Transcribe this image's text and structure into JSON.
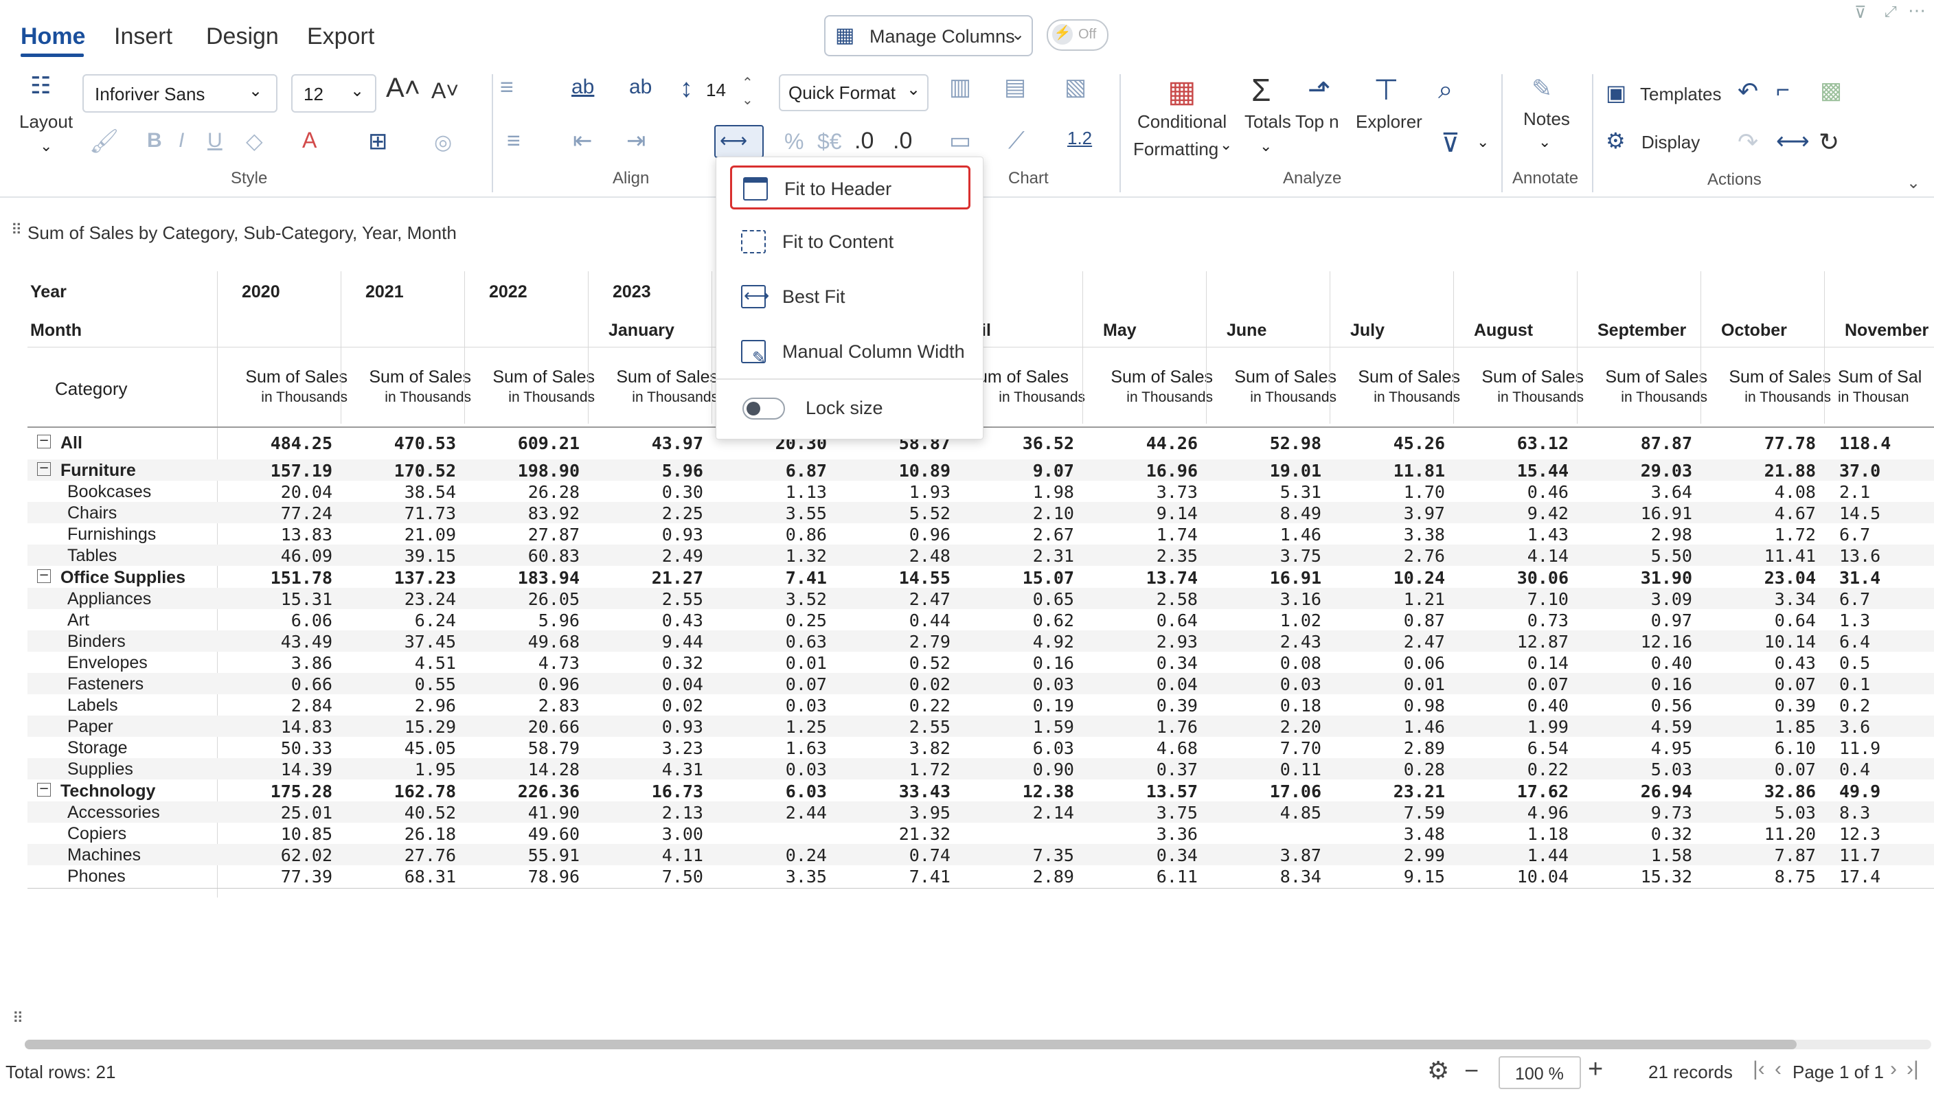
{
  "tabs": [
    "Home",
    "Insert",
    "Design",
    "Export"
  ],
  "manage_columns": {
    "label": "Manage Columns",
    "toggle": "Off"
  },
  "style_group": {
    "label": "Style",
    "layout_label": "Layout",
    "font_family": "Inforiver Sans",
    "font_size": "12",
    "bold": "B",
    "italic": "I",
    "underline": "U"
  },
  "align_group": {
    "label": "Align",
    "line_height": "14",
    "wrap": "ab",
    "wrap2": "ab"
  },
  "number_group": {
    "quick_format": "Quick Format",
    "percent": "%",
    "currency": "$€",
    "inc": ".0",
    "dec": ".0",
    "scale": "1.2"
  },
  "chart_group": {
    "label": "Chart"
  },
  "analyze_group": {
    "label": "Analyze",
    "conditional": "Conditional",
    "formatting": "Formatting",
    "totals": "Totals",
    "top_n": "Top n",
    "explorer": "Explorer"
  },
  "annotate_group": {
    "label": "Annotate",
    "notes": "Notes"
  },
  "actions_group": {
    "label": "Actions",
    "templates": "Templates",
    "display": "Display"
  },
  "title": "Sum of Sales by Category, Sub-Category, Year, Month",
  "popup_menu": {
    "fit_header": "Fit to Header",
    "fit_content": "Fit to Content",
    "best_fit": "Best Fit",
    "manual": "Manual Column Width",
    "lock": "Lock size"
  },
  "header": {
    "year_label": "Year",
    "month_label": "Month",
    "category_label": "Category",
    "years": [
      "2020",
      "2021",
      "2022",
      "2023"
    ],
    "months": [
      "January",
      "April",
      "May",
      "June",
      "July",
      "August",
      "September",
      "October",
      "November"
    ],
    "measure": "Sum of Sales",
    "measure_sub": "in Thousands",
    "measure_partial": "um of Sales",
    "measure_cut": "Sum of Sal",
    "sub_cut": "in Thousan"
  },
  "rows": [
    {
      "cat": "All",
      "level": 0,
      "bold": true,
      "toggle": true,
      "vals": [
        "484.25",
        "470.53",
        "609.21",
        "43.97",
        "20.30",
        "58.87",
        "36.52",
        "44.26",
        "52.98",
        "45.26",
        "63.12",
        "87.87",
        "77.78",
        "118.4"
      ]
    },
    {
      "cat": "Furniture",
      "level": 0,
      "bold": true,
      "toggle": true,
      "vals": [
        "157.19",
        "170.52",
        "198.90",
        "5.96",
        "6.87",
        "10.89",
        "9.07",
        "16.96",
        "19.01",
        "11.81",
        "15.44",
        "29.03",
        "21.88",
        "37.0"
      ]
    },
    {
      "cat": "Bookcases",
      "level": 1,
      "vals": [
        "20.04",
        "38.54",
        "26.28",
        "0.30",
        "1.13",
        "1.93",
        "1.98",
        "3.73",
        "5.31",
        "1.70",
        "0.46",
        "3.64",
        "4.08",
        "2.1"
      ]
    },
    {
      "cat": "Chairs",
      "level": 1,
      "vals": [
        "77.24",
        "71.73",
        "83.92",
        "2.25",
        "3.55",
        "5.52",
        "2.10",
        "9.14",
        "8.49",
        "3.97",
        "9.42",
        "16.91",
        "4.67",
        "14.5"
      ]
    },
    {
      "cat": "Furnishings",
      "level": 1,
      "vals": [
        "13.83",
        "21.09",
        "27.87",
        "0.93",
        "0.86",
        "0.96",
        "2.67",
        "1.74",
        "1.46",
        "3.38",
        "1.43",
        "2.98",
        "1.72",
        "6.7"
      ]
    },
    {
      "cat": "Tables",
      "level": 1,
      "vals": [
        "46.09",
        "39.15",
        "60.83",
        "2.49",
        "1.32",
        "2.48",
        "2.31",
        "2.35",
        "3.75",
        "2.76",
        "4.14",
        "5.50",
        "11.41",
        "13.6"
      ]
    },
    {
      "cat": "Office Supplies",
      "level": 0,
      "bold": true,
      "toggle": true,
      "vals": [
        "151.78",
        "137.23",
        "183.94",
        "21.27",
        "7.41",
        "14.55",
        "15.07",
        "13.74",
        "16.91",
        "10.24",
        "30.06",
        "31.90",
        "23.04",
        "31.4"
      ]
    },
    {
      "cat": "Appliances",
      "level": 1,
      "vals": [
        "15.31",
        "23.24",
        "26.05",
        "2.55",
        "3.52",
        "2.47",
        "0.65",
        "2.58",
        "3.16",
        "1.21",
        "7.10",
        "3.09",
        "3.34",
        "6.7"
      ]
    },
    {
      "cat": "Art",
      "level": 1,
      "vals": [
        "6.06",
        "6.24",
        "5.96",
        "0.43",
        "0.25",
        "0.44",
        "0.62",
        "0.64",
        "1.02",
        "0.87",
        "0.73",
        "0.97",
        "0.64",
        "1.3"
      ]
    },
    {
      "cat": "Binders",
      "level": 1,
      "vals": [
        "43.49",
        "37.45",
        "49.68",
        "9.44",
        "0.63",
        "2.79",
        "4.92",
        "2.93",
        "2.43",
        "2.47",
        "12.87",
        "12.16",
        "10.14",
        "6.4"
      ]
    },
    {
      "cat": "Envelopes",
      "level": 1,
      "vals": [
        "3.86",
        "4.51",
        "4.73",
        "0.32",
        "0.01",
        "0.52",
        "0.16",
        "0.34",
        "0.08",
        "0.06",
        "0.14",
        "0.40",
        "0.43",
        "0.5"
      ]
    },
    {
      "cat": "Fasteners",
      "level": 1,
      "vals": [
        "0.66",
        "0.55",
        "0.96",
        "0.04",
        "0.07",
        "0.02",
        "0.03",
        "0.04",
        "0.03",
        "0.01",
        "0.07",
        "0.16",
        "0.07",
        "0.1"
      ]
    },
    {
      "cat": "Labels",
      "level": 1,
      "vals": [
        "2.84",
        "2.96",
        "2.83",
        "0.02",
        "0.03",
        "0.22",
        "0.19",
        "0.39",
        "0.18",
        "0.98",
        "0.40",
        "0.56",
        "0.39",
        "0.2"
      ]
    },
    {
      "cat": "Paper",
      "level": 1,
      "vals": [
        "14.83",
        "15.29",
        "20.66",
        "0.93",
        "1.25",
        "2.55",
        "1.59",
        "1.76",
        "2.20",
        "1.46",
        "1.99",
        "4.59",
        "1.85",
        "3.6"
      ]
    },
    {
      "cat": "Storage",
      "level": 1,
      "vals": [
        "50.33",
        "45.05",
        "58.79",
        "3.23",
        "1.63",
        "3.82",
        "6.03",
        "4.68",
        "7.70",
        "2.89",
        "6.54",
        "4.95",
        "6.10",
        "11.9"
      ]
    },
    {
      "cat": "Supplies",
      "level": 1,
      "vals": [
        "14.39",
        "1.95",
        "14.28",
        "4.31",
        "0.03",
        "1.72",
        "0.90",
        "0.37",
        "0.11",
        "0.28",
        "0.22",
        "5.03",
        "0.07",
        "0.4"
      ]
    },
    {
      "cat": "Technology",
      "level": 0,
      "bold": true,
      "toggle": true,
      "vals": [
        "175.28",
        "162.78",
        "226.36",
        "16.73",
        "6.03",
        "33.43",
        "12.38",
        "13.57",
        "17.06",
        "23.21",
        "17.62",
        "26.94",
        "32.86",
        "49.9"
      ]
    },
    {
      "cat": "Accessories",
      "level": 1,
      "vals": [
        "25.01",
        "40.52",
        "41.90",
        "2.13",
        "2.44",
        "3.95",
        "2.14",
        "3.75",
        "4.85",
        "7.59",
        "4.96",
        "9.73",
        "5.03",
        "8.3"
      ]
    },
    {
      "cat": "Copiers",
      "level": 1,
      "vals": [
        "10.85",
        "26.18",
        "49.60",
        "3.00",
        "",
        "21.32",
        "",
        "3.36",
        "",
        "3.48",
        "1.18",
        "0.32",
        "11.20",
        "12.3"
      ]
    },
    {
      "cat": "Machines",
      "level": 1,
      "vals": [
        "62.02",
        "27.76",
        "55.91",
        "4.11",
        "0.24",
        "0.74",
        "7.35",
        "0.34",
        "3.87",
        "2.99",
        "1.44",
        "1.58",
        "7.87",
        "11.7"
      ]
    },
    {
      "cat": "Phones",
      "level": 1,
      "vals": [
        "77.39",
        "68.31",
        "78.96",
        "7.50",
        "3.35",
        "7.41",
        "2.89",
        "6.11",
        "8.34",
        "9.15",
        "10.04",
        "15.32",
        "8.75",
        "17.4"
      ]
    }
  ],
  "footer": {
    "total_rows": "Total rows: 21",
    "zoom": "100 %",
    "records": "21 records",
    "page": "Page 1 of 1"
  },
  "colors": {
    "accent": "#1a4f9c",
    "highlight": "#d9302f"
  }
}
